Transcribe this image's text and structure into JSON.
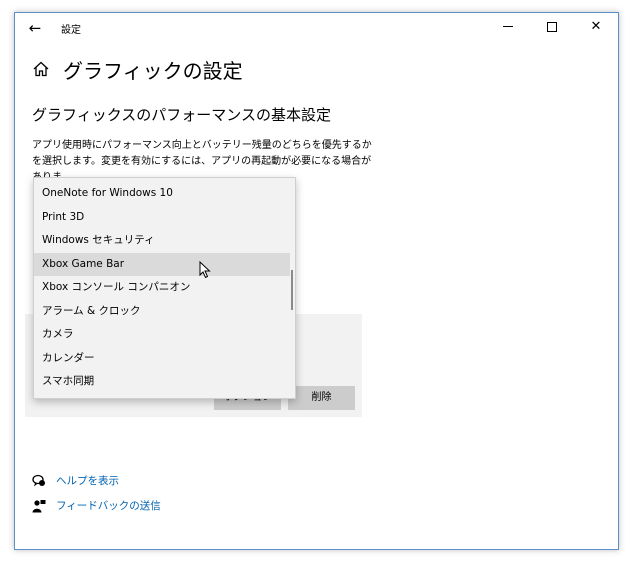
{
  "window": {
    "title": "設定",
    "back_glyph": "←",
    "close_glyph": "✕"
  },
  "page": {
    "title": "グラフィックの設定",
    "section_title": "グラフィックスのパフォーマンスの基本設定",
    "description": "アプリ使用時にパフォーマンス向上とバッテリー残量のどちらを優先するかを選択します。変更を有効にするには、アプリの再起動が必要になる場合がありま"
  },
  "dropdown": {
    "items": [
      "OneNote for Windows 10",
      "Print 3D",
      "Windows セキュリティ",
      "Xbox Game Bar",
      "Xbox コンソール コンパニオン",
      "アラーム & クロック",
      "カメラ",
      "カレンダー",
      "スマホ同期"
    ],
    "hovered": "Xbox Game Bar"
  },
  "app_panel": {
    "options_label": "オプション",
    "remove_label": "削除"
  },
  "help": {
    "show_help": "ヘルプを表示",
    "send_feedback": "フィードバックの送信"
  },
  "colors": {
    "link": "#0063b1",
    "window_border": "#5b8fc7",
    "panel_bg": "#f2f2f2",
    "button_bg": "#cccccc",
    "hover_bg": "#dadada"
  },
  "icons": {
    "back": "back-arrow-icon",
    "home": "home-icon",
    "minimize": "minimize-icon",
    "maximize": "maximize-icon",
    "close": "close-icon",
    "help": "help-chat-icon",
    "feedback": "feedback-person-icon",
    "cursor": "mouse-cursor-icon"
  }
}
